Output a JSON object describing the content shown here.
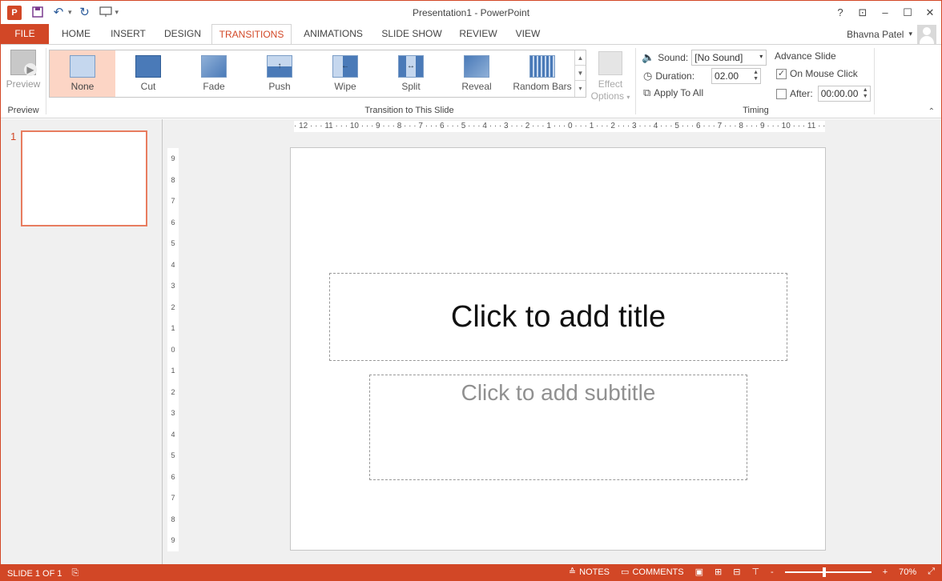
{
  "window": {
    "title": "Presentation1 - PowerPoint",
    "app_icon": "P",
    "controls": [
      "?",
      "⊡",
      "–",
      "☐",
      "✕"
    ]
  },
  "tabs": [
    {
      "label": "FILE"
    },
    {
      "label": "HOME"
    },
    {
      "label": "INSERT"
    },
    {
      "label": "DESIGN"
    },
    {
      "label": "TRANSITIONS",
      "active": true
    },
    {
      "label": "ANIMATIONS"
    },
    {
      "label": "SLIDE SHOW"
    },
    {
      "label": "REVIEW"
    },
    {
      "label": "VIEW"
    }
  ],
  "user": {
    "name": "Bhavna Patel",
    "caret": "▾"
  },
  "ribbon": {
    "preview": {
      "button": "Preview",
      "group": "Preview"
    },
    "transitions": {
      "group": "Transition to This Slide",
      "items": [
        "None",
        "Cut",
        "Fade",
        "Push",
        "Wipe",
        "Split",
        "Reveal",
        "Random Bars"
      ],
      "selected": "None"
    },
    "effect_options": {
      "line1": "Effect",
      "line2": "Options"
    },
    "timing": {
      "group": "Timing",
      "sound_label": "Sound:",
      "sound_value": "[No Sound]",
      "duration_label": "Duration:",
      "duration_value": "02.00",
      "apply_all": "Apply To All",
      "advance_title": "Advance Slide",
      "on_mouse_click": "On Mouse Click",
      "on_mouse_click_checked": true,
      "after_label": "After:",
      "after_value": "00:00.00",
      "after_checked": false
    }
  },
  "thumbs": {
    "number": "1"
  },
  "ruler": {
    "horizontal": "· 12 · · · 11 · · · 10 · · · 9 · · · 8 · · · 7 · · · 6 · · · 5 · · · 4 · · · 3 · · · 2 · · · 1 · · · 0 · · · 1 · · · 2 · · · 3 · · · 4 · · · 5 · · · 6 · · · 7 · · · 8 · · · 9 · · · 10 · · · 11 · · · 12 ·",
    "vertical": [
      "9",
      "8",
      "7",
      "6",
      "5",
      "4",
      "3",
      "2",
      "1",
      "0",
      "1",
      "2",
      "3",
      "4",
      "5",
      "6",
      "7",
      "8",
      "9"
    ]
  },
  "slide": {
    "title_placeholder": "Click to add title",
    "subtitle_placeholder": "Click to add subtitle"
  },
  "status": {
    "slide_info": "SLIDE 1 OF 1",
    "notes": "NOTES",
    "comments": "COMMENTS",
    "zoom_minus": "-",
    "zoom_plus": "+",
    "zoom": "70%",
    "zoom_fraction": 0.45
  }
}
